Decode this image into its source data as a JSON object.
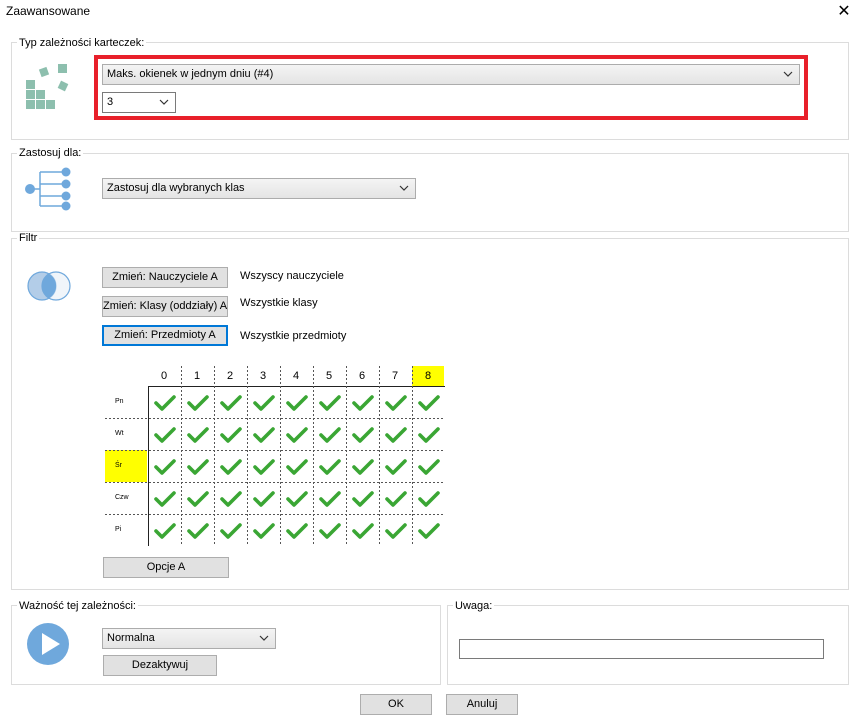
{
  "window": {
    "title": "Zaawansowane"
  },
  "type_group": {
    "label": "Typ zależności karteczek:",
    "type_value": "Maks. okienek w jednym dniu (#4)",
    "count_value": "3"
  },
  "apply_group": {
    "label": "Zastosuj dla:",
    "value": "Zastosuj dla wybranych klas"
  },
  "filter_group": {
    "label": "Filtr",
    "rows": [
      {
        "button": "Zmień: Nauczyciele A",
        "text": "Wszyscy nauczyciele"
      },
      {
        "button": "Zmień: Klasy (oddziały) A",
        "text": "Wszystkie klasy"
      },
      {
        "button": "Zmień: Przedmioty A",
        "text": "Wszystkie przedmioty"
      }
    ],
    "periods": [
      "0",
      "1",
      "2",
      "3",
      "4",
      "5",
      "6",
      "7",
      "8"
    ],
    "highlight_period": "8",
    "days": [
      "Pn",
      "Wt",
      "Śr",
      "Czw",
      "Pi"
    ],
    "highlight_day": "Śr",
    "options_button": "Opcje A"
  },
  "importance_group": {
    "label": "Ważność tej zależności:",
    "value": "Normalna",
    "deactivate_button": "Dezaktywuj"
  },
  "note_group": {
    "label": "Uwaga:",
    "value": ""
  },
  "footer": {
    "ok": "OK",
    "cancel": "Anuluj"
  },
  "colors": {
    "highlight": "#ffff00",
    "check": "#3aa634",
    "focus_box": "#e8202a",
    "icon_teal": "#8dbfae",
    "icon_blue": "#6fa8dc"
  }
}
